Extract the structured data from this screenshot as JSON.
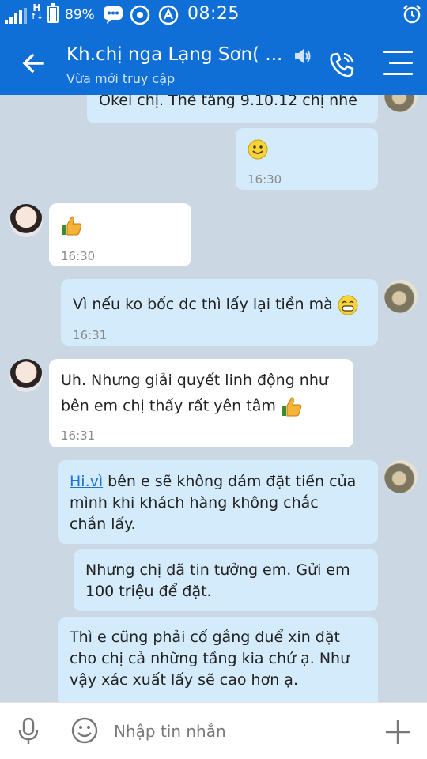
{
  "status_bar": {
    "network": "H",
    "battery_percent": "89%",
    "battery_level": 0.89,
    "time": "08:25"
  },
  "header": {
    "title": "Kh.chị nga Lạng Sơn( ...",
    "subtitle": "Vừa mới truy cập",
    "icons": [
      "back-arrow-icon",
      "speaker-icon",
      "phone-icon",
      "menu-icon"
    ]
  },
  "messages": [
    {
      "side": "out",
      "text": "Okei chị. Thế tầng 9.10.12 chị nhé",
      "time": ""
    },
    {
      "side": "out",
      "emoji": "smile-emoji",
      "time": "16:30"
    },
    {
      "side": "in",
      "emoji": "thumbs-up-emoji",
      "time": "16:30"
    },
    {
      "side": "out",
      "text": "Vì nếu ko bốc dc thì lấy lại tiền mà",
      "emoji": "grin-emoji",
      "time": "16:31"
    },
    {
      "side": "in",
      "line1": "Uh. Nhưng giải quyết linh động như",
      "line2": "bên em chị thấy rất yên tâm",
      "emoji": "thumbs-up-emoji",
      "time": "16:31"
    },
    {
      "side": "out",
      "link": "Hi.vì",
      "text_after_link": " bên e sẽ không dám đặt tiền của",
      "line2": "mình khi khách hàng không chắc",
      "line3": "chắn lấy."
    },
    {
      "side": "out",
      "line1": "Nhưng chị đã tin tưởng em. Gửi em",
      "line2": "100 triệu để đặt."
    },
    {
      "side": "out",
      "line1": "Thì e cũng phải cố gắng đuể xin đặt",
      "line2": "cho chị cả những tầng kia chứ ạ. Như",
      "line3": "vậy xác xuất lấy sẽ cao hơn ạ."
    }
  ],
  "input": {
    "placeholder": "Nhập tin nhắn",
    "icons": [
      "microphone-icon",
      "sticker-icon",
      "plus-icon"
    ]
  },
  "colors": {
    "header_bg": "#0f6fd7",
    "chat_bg": "#cbd8e4",
    "outgoing_bubble": "#d4ebfb",
    "incoming_bubble": "#ffffff",
    "link": "#1a73d5"
  }
}
